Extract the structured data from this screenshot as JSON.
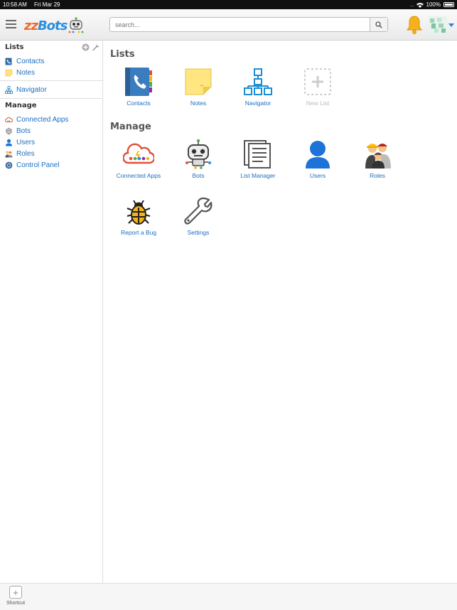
{
  "status_bar": {
    "time": "10:58 AM",
    "date": "Fri Mar 29",
    "battery": "100%"
  },
  "header": {
    "logo_zz": "zz",
    "logo_bots": "Bots",
    "search_placeholder": "search..."
  },
  "sidebar": {
    "lists_heading": "Lists",
    "lists": [
      {
        "label": "Contacts",
        "icon": "contacts-icon"
      },
      {
        "label": "Notes",
        "icon": "notes-icon"
      }
    ],
    "navigator_label": "Navigator",
    "manage_heading": "Manage",
    "manage": [
      {
        "label": "Connected Apps",
        "icon": "cloud-icon"
      },
      {
        "label": "Bots",
        "icon": "robot-icon"
      },
      {
        "label": "Users",
        "icon": "user-icon"
      },
      {
        "label": "Roles",
        "icon": "roles-icon"
      },
      {
        "label": "Control Panel",
        "icon": "gear-icon"
      }
    ]
  },
  "main": {
    "lists_title": "Lists",
    "lists_tiles": [
      {
        "label": "Contacts",
        "icon": "contacts-book-icon"
      },
      {
        "label": "Notes",
        "icon": "note-icon"
      },
      {
        "label": "Navigator",
        "icon": "sitemap-icon"
      },
      {
        "label": "New List",
        "icon": "add-list-icon"
      }
    ],
    "manage_title": "Manage",
    "manage_tiles": [
      {
        "label": "Connected Apps",
        "icon": "cloud-apps-icon"
      },
      {
        "label": "Bots",
        "icon": "robot-icon"
      },
      {
        "label": "List Manager",
        "icon": "list-manager-icon"
      },
      {
        "label": "Users",
        "icon": "user-icon"
      },
      {
        "label": "Roles",
        "icon": "roles-icon"
      },
      {
        "label": "Report a Bug",
        "icon": "bug-icon"
      },
      {
        "label": "Settings",
        "icon": "wrench-icon"
      }
    ]
  },
  "bottom_bar": {
    "shortcut_label": "Shortcut"
  },
  "colors": {
    "link": "#1a6fc4",
    "accent_orange": "#f06a2a",
    "accent_blue": "#2a8fe0",
    "bell": "#f5b21b"
  }
}
